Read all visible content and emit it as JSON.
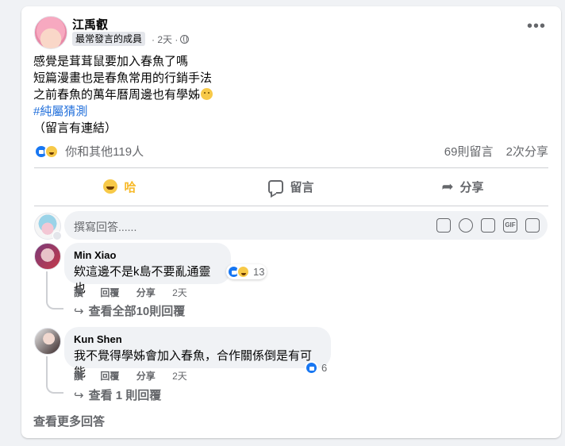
{
  "post": {
    "author": "江禹叡",
    "badge": "最常發言的成員",
    "time": "2天",
    "more": "•••",
    "lines": [
      "感覺是茸茸鼠要加入春魚了嗎",
      "短篇漫畫也是春魚常用的行銷手法",
      "之前春魚的萬年曆周邊也有學姊"
    ],
    "hashtag": "#純屬猜測",
    "note": "（留言有連結）"
  },
  "stats": {
    "reactions_text": "你和其他119人",
    "comments": "69則留言",
    "shares": "2次分享"
  },
  "actions": {
    "haha": "哈",
    "comment": "留言",
    "share": "分享"
  },
  "composer": {
    "placeholder": "撰寫回答......",
    "gif_label": "GIF"
  },
  "comments": [
    {
      "name": "Min Xiao",
      "text": "欸這邊不是k島不要亂通靈也",
      "reaction_count": "13",
      "action_like": "讚",
      "action_reply": "回覆",
      "action_share": "分享",
      "time": "2天",
      "view_replies": "查看全部10則回覆"
    },
    {
      "name": "Kun Shen",
      "text": "我不覺得學姊會加入春魚，合作關係倒是有可能",
      "reaction_count": "6",
      "action_like": "讚",
      "action_reply": "回覆",
      "action_share": "分享",
      "time": "2天",
      "view_replies": "查看 1 則回覆"
    }
  ],
  "more_comments": "查看更多回答",
  "colors": {
    "accent_blue": "#1877f2",
    "haha_yellow": "#f7b928",
    "hashtag": "#216fdb"
  }
}
